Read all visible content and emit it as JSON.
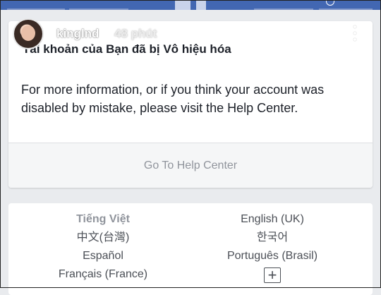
{
  "story": {
    "username": "kinglnd",
    "time": "48 phút"
  },
  "card": {
    "title": "Tài khoản của Bạn đã bị Vô hiệu hóa",
    "body": "For more information, or if you think your account was disabled by mistake, please visit the Help Center.",
    "button": "Go To Help Center"
  },
  "languages": {
    "left": [
      "Tiếng Việt",
      "中文(台灣)",
      "Español",
      "Français (France)"
    ],
    "right": [
      "English (UK)",
      "한국어",
      "Português (Brasil)"
    ],
    "more": "+"
  },
  "colors": {
    "brand_blue": "#4267b2",
    "background": "#e9ebee",
    "muted_text": "#90949c"
  }
}
